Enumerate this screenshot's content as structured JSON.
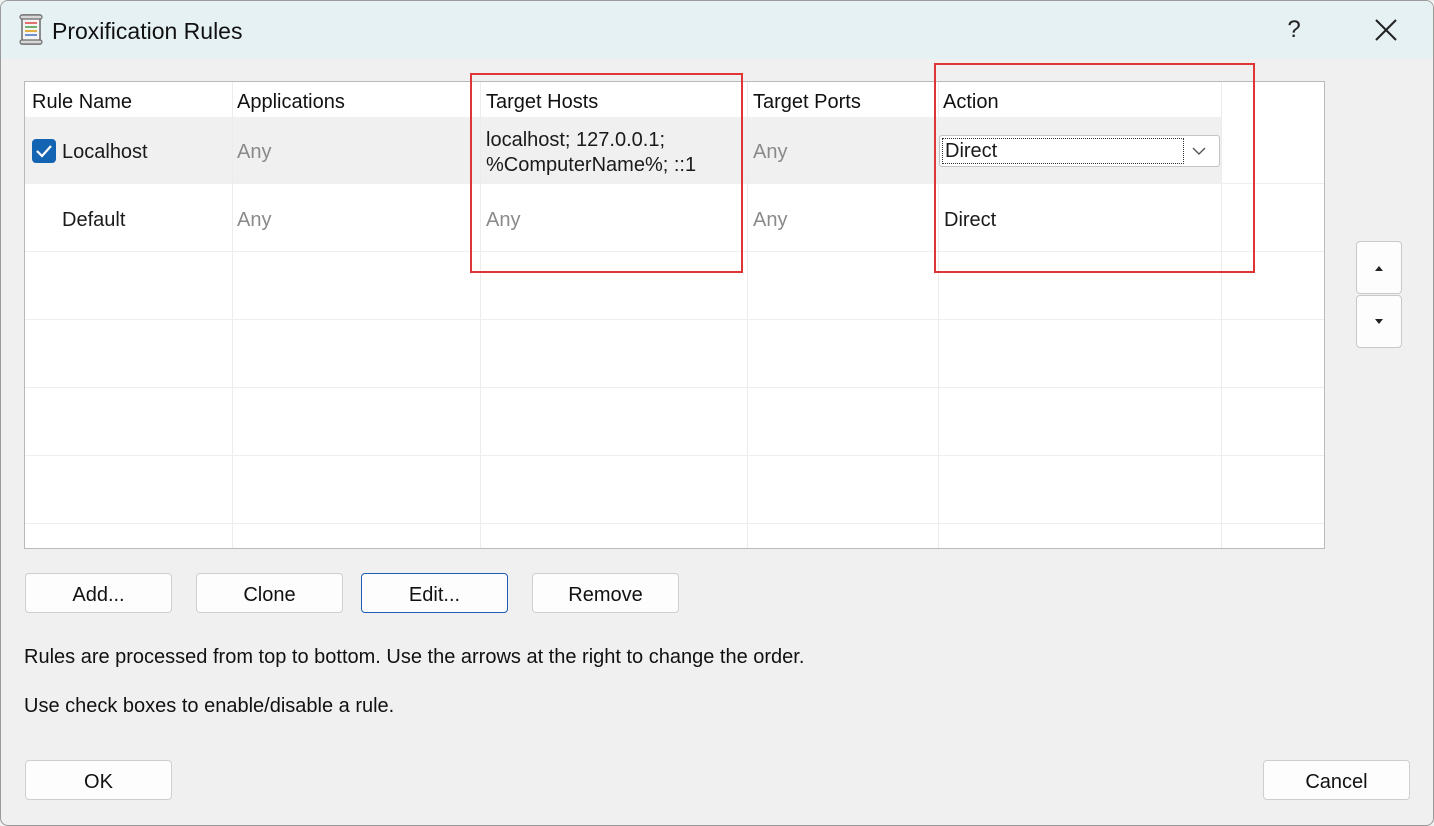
{
  "window": {
    "title": "Proxification Rules",
    "help_label": "?",
    "icons": {
      "app": "rules-scroll-icon",
      "close": "close-icon"
    }
  },
  "table": {
    "columns": [
      "Rule Name",
      "Applications",
      "Target Hosts",
      "Target Ports",
      "Action"
    ],
    "rows": [
      {
        "enabled": true,
        "name": "Localhost",
        "applications": "Any",
        "target_hosts_line1": "localhost; 127.0.0.1;",
        "target_hosts_line2": "%ComputerName%; ::1",
        "target_ports": "Any",
        "action": "Direct",
        "selected": true
      },
      {
        "name": "Default",
        "applications": "Any",
        "target_hosts": "Any",
        "target_ports": "Any",
        "action": "Direct"
      }
    ]
  },
  "order_buttons": {
    "up_icon": "triangle-up-icon",
    "down_icon": "triangle-down-icon"
  },
  "buttons": {
    "add": "Add...",
    "clone": "Clone",
    "edit": "Edit...",
    "remove": "Remove",
    "ok": "OK",
    "cancel": "Cancel"
  },
  "info": {
    "line1": "Rules are processed from top to bottom. Use the arrows at the right to change the order.",
    "line2": "Use check boxes to enable/disable a rule."
  },
  "highlight_color": "#e03535",
  "accent_color": "#1464b4"
}
